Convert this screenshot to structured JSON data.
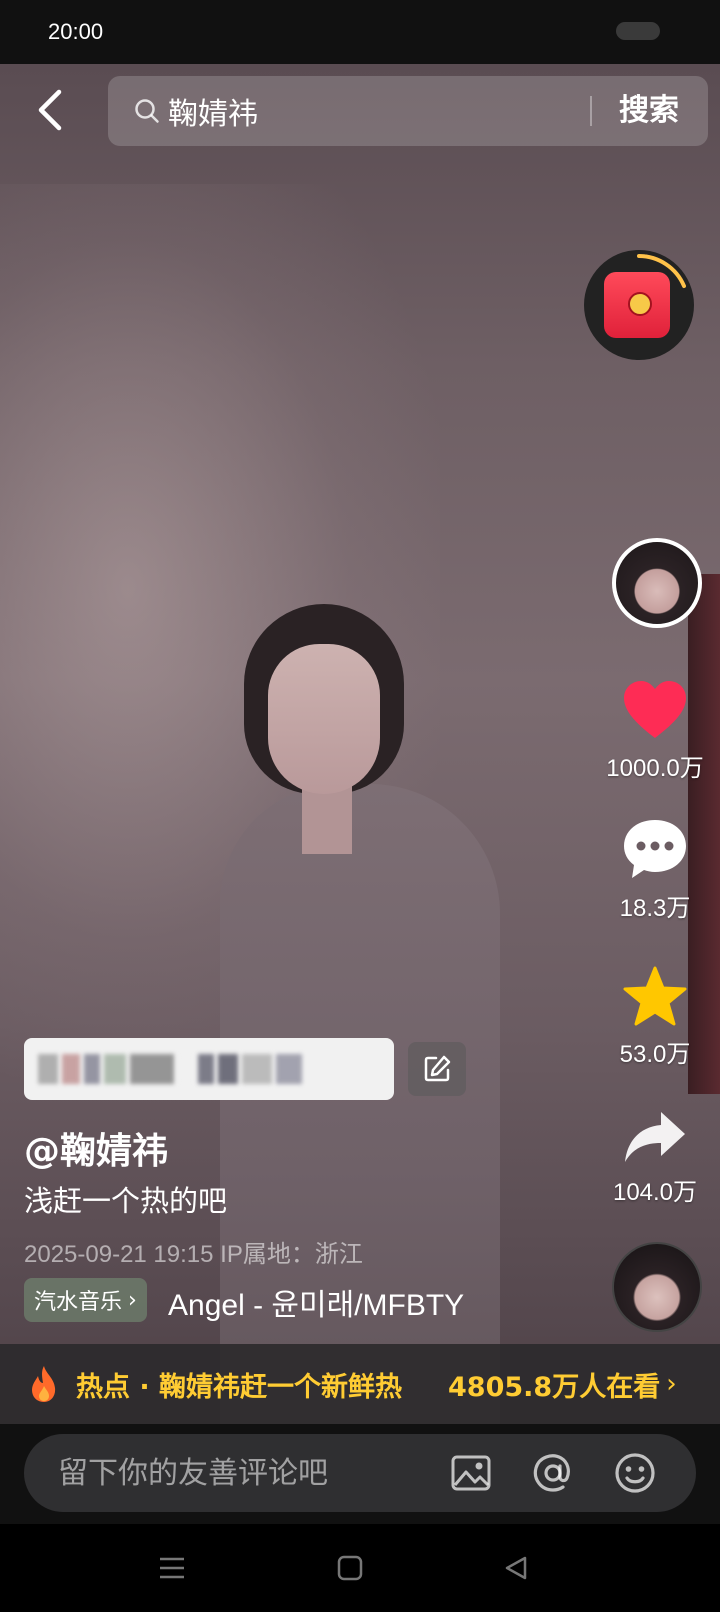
{
  "status_bar": {
    "time": "20:00"
  },
  "search": {
    "query": "鞠婧祎",
    "button_label": "搜索"
  },
  "actions": {
    "likes": "1000.0万",
    "comments": "18.3万",
    "favorites": "53.0万",
    "shares": "104.0万"
  },
  "video": {
    "author": "@鞠婧祎",
    "caption": "浅赶一个热的吧",
    "timestamp": "2025-09-21 19:15",
    "ip_location": "IP属地：浙江",
    "music_tag": "汽水音乐",
    "song": "Angel - 윤미래/MFBTY"
  },
  "hot_bar": {
    "title": "热点 · 鞠婧祎赶一个新鲜热",
    "viewers": "4805.8万人在看"
  },
  "comment": {
    "placeholder": "留下你的友善评论吧"
  },
  "colors": {
    "accent_yellow": "#ffcc33",
    "like_red": "#fe2c55",
    "star_yellow": "#ffc700"
  }
}
